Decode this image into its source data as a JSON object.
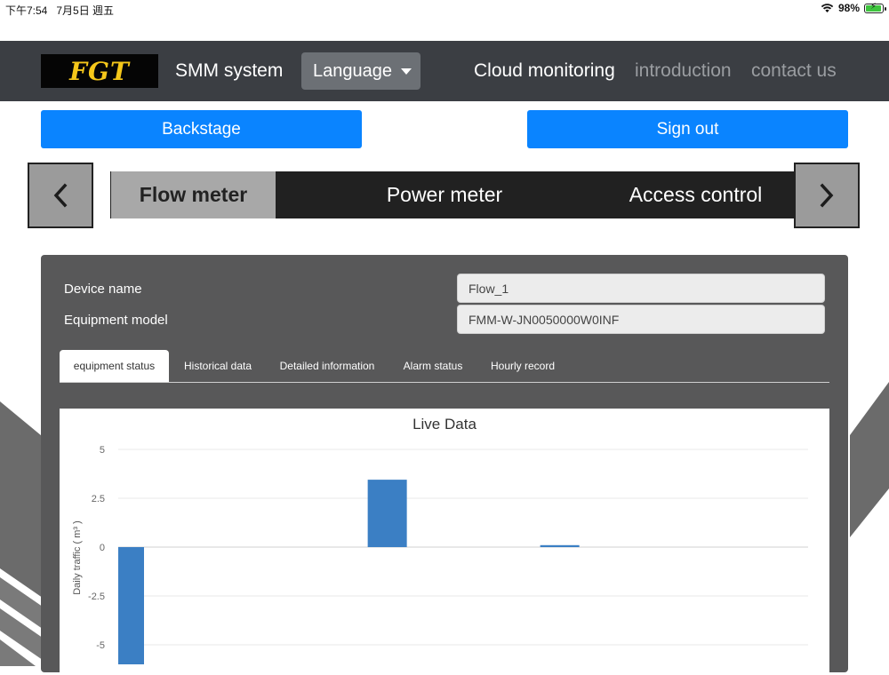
{
  "status_bar": {
    "time": "下午7:54",
    "date": "7月5日 週五",
    "battery_percent": "98%",
    "battery_level": 0.98
  },
  "navbar": {
    "logo_text": "FGT",
    "brand": "SMM system",
    "language_button": "Language",
    "links": {
      "active": "Cloud monitoring",
      "introduction": "introduction",
      "contact": "contact us"
    }
  },
  "actions": {
    "backstage": "Backstage",
    "signout": "Sign out"
  },
  "device_tabs": {
    "flow": "Flow meter",
    "power": "Power meter",
    "access": "Access control"
  },
  "device": {
    "name_label": "Device name",
    "name_value": "Flow_1",
    "model_label": "Equipment model",
    "model_value": "FMM-W-JN0050000W0INF"
  },
  "sub_tabs": [
    "equipment status",
    "Historical data",
    "Detailed information",
    "Alarm status",
    "Hourly record"
  ],
  "colors": {
    "accent_blue": "#0a84ff",
    "navbar": "#3b3e43",
    "panel": "#585859",
    "bar": "#3b7fc4"
  },
  "chart_data": {
    "type": "bar",
    "title": "Live Data",
    "ylabel": "Daily traffic ( m³ )",
    "xlabel": "",
    "ylim": [
      -5.9,
      5.6
    ],
    "yticks": [
      5,
      2.5,
      0,
      -2.5,
      -5
    ],
    "ytick_labels": [
      "5",
      "2.5",
      "0",
      "-2.5",
      "-5"
    ],
    "categories": [
      "",
      "",
      "",
      ""
    ],
    "values": [
      -6,
      3.45,
      0.1,
      0
    ],
    "grid": true
  }
}
